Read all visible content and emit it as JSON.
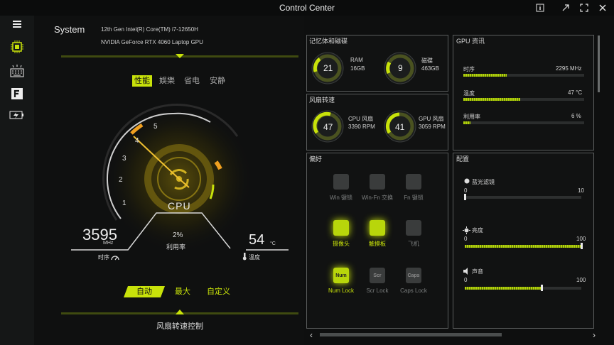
{
  "app": {
    "title": "Control Center"
  },
  "system": {
    "heading": "System",
    "cpu_name": "12th Gen Intel(R) Core(TM) i7-12650H",
    "gpu_name": "NVIDIA GeForce RTX 4060 Laptop GPU"
  },
  "modes": {
    "items": [
      "性能",
      "娛樂",
      "省电",
      "安静"
    ],
    "active": "性能"
  },
  "gauge": {
    "ticks": [
      "1",
      "2",
      "3",
      "4",
      "5"
    ],
    "label": "CPU",
    "clock_value": "3595",
    "clock_unit": "MHz",
    "clock_label": "时序",
    "util_value": "2%",
    "util_label": "利用率",
    "temp_value": "54",
    "temp_unit": "°C",
    "temp_label": "温度",
    "clock_fraction": 0.72,
    "temp_fraction": 0.54
  },
  "fan_modes": {
    "items": [
      "自动",
      "最大",
      "自定义"
    ],
    "active": "自动"
  },
  "fan_control_label": "风扇转速控制",
  "memory": {
    "title": "记忆体和磁碟",
    "ram_value": "21",
    "ram_label": "RAM",
    "ram_size": "16GB",
    "disk_value": "9",
    "disk_label": "磁碟",
    "disk_size": "463GB"
  },
  "fans": {
    "title": "风扇转速",
    "cpu_value": "47",
    "cpu_label": "CPU 风扇",
    "cpu_rpm": "3390 RPM",
    "gpu_value": "41",
    "gpu_label": "GPU 风扇",
    "gpu_rpm": "3059 RPM"
  },
  "gpu": {
    "title": "GPU 资讯",
    "rows": [
      {
        "label": "时序",
        "value": "2295 MHz",
        "fraction": 0.36
      },
      {
        "label": "温度",
        "value": "47 °C",
        "fraction": 0.47
      },
      {
        "label": "利用率",
        "value": "6 %",
        "fraction": 0.06
      }
    ]
  },
  "prefs": {
    "title": "偏好",
    "items": [
      {
        "label": "Win 键锁",
        "icon": "windows-icon",
        "on": false
      },
      {
        "label": "Win-Fn 交换",
        "icon": "win-fn-swap-icon",
        "on": false
      },
      {
        "label": "Fn 键锁",
        "icon": "fn-lock-icon",
        "on": false
      },
      {
        "label": "摄像头",
        "icon": "camera-icon",
        "on": true
      },
      {
        "label": "触摸板",
        "icon": "touchpad-icon",
        "on": true
      },
      {
        "label": "飞机",
        "icon": "airplane-icon",
        "on": false
      },
      {
        "label": "Num Lock",
        "icon": "num-lock-icon",
        "on": true,
        "key": "Num"
      },
      {
        "label": "Scr Lock",
        "icon": "scroll-lock-icon",
        "on": false,
        "key": "Scr"
      },
      {
        "label": "Caps Lock",
        "icon": "caps-lock-icon",
        "on": false,
        "key": "Caps"
      }
    ]
  },
  "config": {
    "title": "配置",
    "blue_light": {
      "label": "蓝光滤镜",
      "min": "0",
      "max": "10",
      "fraction": 0.0
    },
    "brightness": {
      "label": "亮度",
      "min": "0",
      "max": "100",
      "fraction": 1.0
    },
    "volume": {
      "label": "声音",
      "min": "0",
      "max": "100",
      "fraction": 0.66
    }
  },
  "colors": {
    "accent": "#c8e20a",
    "orange": "#f0a020",
    "bg": "#0e0f0f"
  }
}
